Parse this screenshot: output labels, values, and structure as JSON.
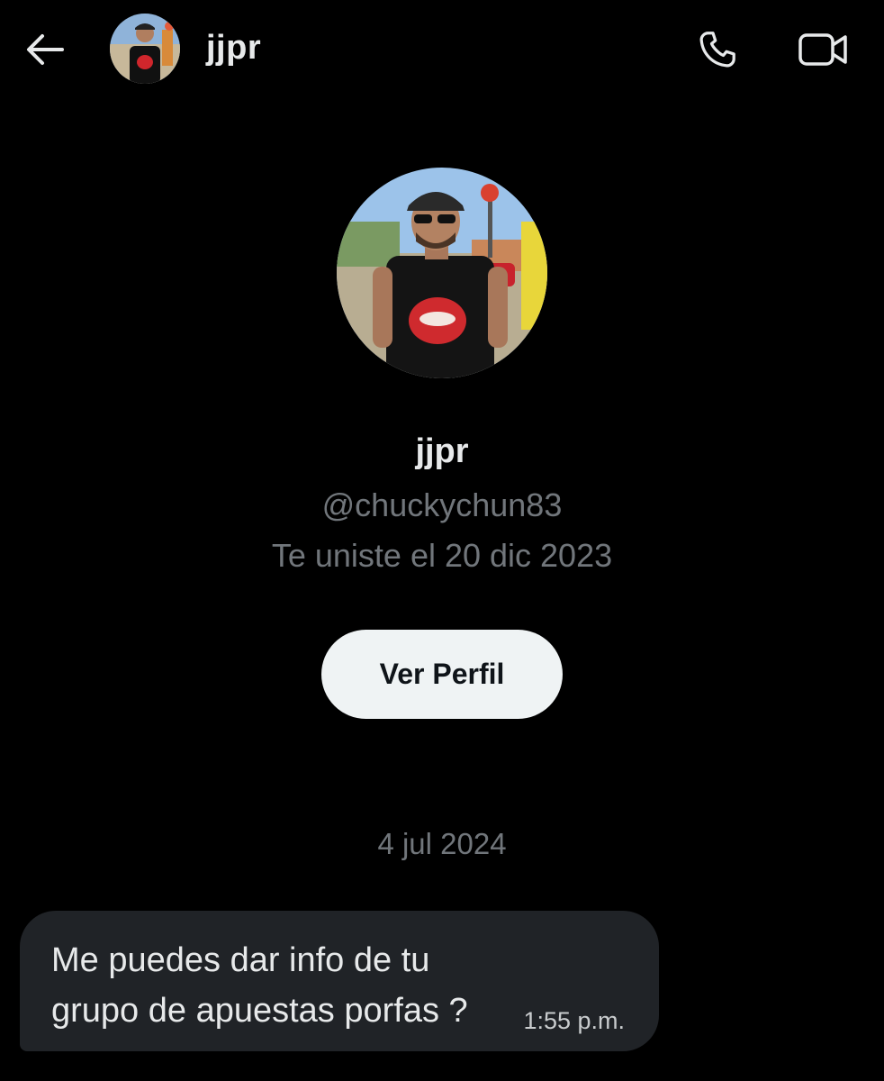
{
  "header": {
    "back_icon": "arrow-left-icon",
    "name": "jjpr",
    "call_icon": "phone-icon",
    "video_icon": "video-camera-icon"
  },
  "profile": {
    "name": "jjpr",
    "handle": "@chuckychun83",
    "joined": "Te uniste el 20 dic 2023",
    "view_profile_label": "Ver Perfil"
  },
  "conversation": {
    "date_divider": "4 jul 2024",
    "messages": [
      {
        "text": "Me puedes dar info de tu grupo de apuestas porfas ?",
        "time": "1:55 p.m."
      }
    ]
  },
  "colors": {
    "background": "#000000",
    "primary_text": "#e7e9ea",
    "secondary_text": "#71767b",
    "bubble": "#202327",
    "button_bg": "#eff3f4"
  }
}
